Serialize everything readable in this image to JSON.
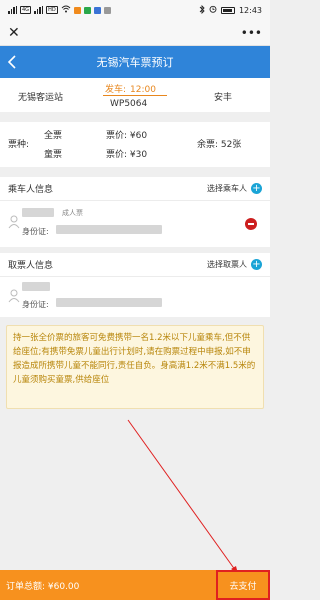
{
  "status_bar": {
    "left_tags": [
      "4G",
      "HD"
    ],
    "right_time": "12:43",
    "battery_icon": "battery-icon"
  },
  "wechat_bar": {
    "close_icon": "close-icon",
    "more_icon": "more-dots-icon",
    "more_text": "•••"
  },
  "header": {
    "title": "无锡汽车票预订",
    "back_icon": "chevron-left-icon"
  },
  "trip": {
    "from": "无锡客运站",
    "depart_label": "发车:",
    "depart_time": "12:00",
    "bus_no": "WP5064",
    "to": "安丰"
  },
  "tickets": {
    "type_label": "票种:",
    "full_label": "全票",
    "child_label": "童票",
    "full_price": "票价: ¥60",
    "child_price": "票价: ¥30",
    "remaining": "余票: 52张"
  },
  "passenger_section": {
    "title": "乘车人信息",
    "action": "选择乘车人",
    "passenger_type": "成人票",
    "id_label": "身份证:"
  },
  "pickup_section": {
    "title": "取票人信息",
    "action": "选择取票人",
    "id_label": "身份证:"
  },
  "notice": {
    "text": "持一张全价票的旅客可免费携带一名1.2米以下儿童乘车,但不供给座位;有携带免票儿童出行计划时,请在购票过程中申报,如不申报造成所携带儿童不能同行,责任自负。身高满1.2米不满1.5米的儿童须购买童票,供给座位"
  },
  "footer": {
    "total_label": "订单总额: ¥60.00",
    "pay_button": "去支付"
  },
  "colors": {
    "header_blue": "#2f84d9",
    "accent_orange": "#f7911e",
    "notice_text": "#b8860b",
    "add_blue": "#1aa4d6",
    "delete_red": "#cc1e1e"
  }
}
